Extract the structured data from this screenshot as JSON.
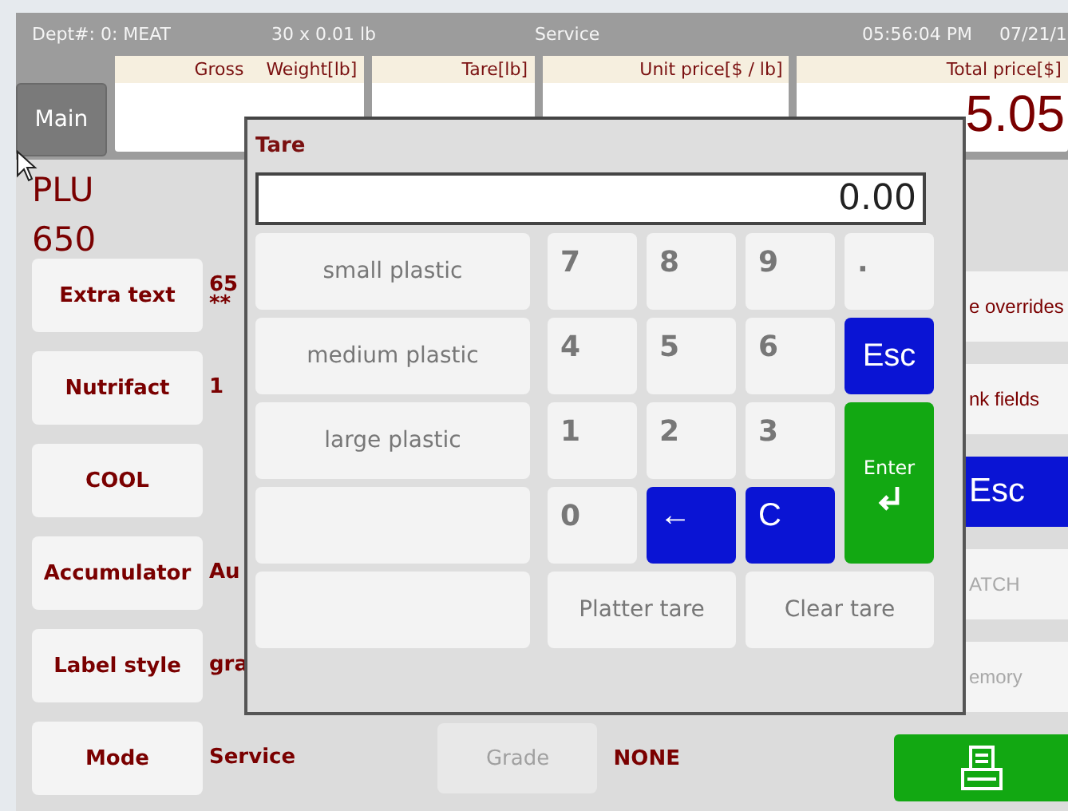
{
  "status_bar": {
    "department": "Dept#: 0: MEAT",
    "tare_info": "30 x 0.01 lb",
    "mode": "Service",
    "time": "05:56:04 PM",
    "date": "07/21/1"
  },
  "main_button": "Main",
  "readouts": [
    {
      "label": "Gross    Weight[lb]"
    },
    {
      "label": "Tare[lb]"
    },
    {
      "label": "Unit price[$ / lb]"
    },
    {
      "label": "Total price[$]",
      "value": "5.05"
    }
  ],
  "plu": {
    "label": "PLU",
    "number": "650"
  },
  "fields": [
    {
      "button": "Extra text",
      "value": "65",
      "value_line_2": "**"
    },
    {
      "button": "Nutrifact",
      "value": "1"
    },
    {
      "button": "COOL"
    },
    {
      "button": "Accumulator",
      "value": "Au"
    },
    {
      "button": "Label style",
      "value": "gra"
    },
    {
      "button": "Mode",
      "value": "Service"
    }
  ],
  "grade": {
    "button": "Grade",
    "disabled": true,
    "value": "NONE"
  },
  "side_buttons": [
    {
      "kind": "normal",
      "label": "e overrides",
      "disabled": false
    },
    {
      "kind": "normal",
      "label": "nk fields",
      "disabled": false
    },
    {
      "kind": "blue",
      "label": "Esc"
    },
    {
      "kind": "normal",
      "label": "ATCH",
      "disabled": true
    },
    {
      "kind": "normal",
      "label": "emory",
      "disabled": true
    },
    {
      "kind": "print"
    }
  ],
  "tare_dialog": {
    "title": "Tare",
    "value": "0.00",
    "presets": [
      {
        "kind": "preset",
        "label": "small plastic"
      },
      {
        "kind": "preset",
        "label": "medium plastic"
      },
      {
        "kind": "preset",
        "label": "large plastic"
      },
      {
        "kind": "empty"
      },
      {
        "kind": "empty"
      }
    ],
    "keys": [
      {
        "kind": "digit",
        "label": "7"
      },
      {
        "kind": "digit",
        "label": "8"
      },
      {
        "kind": "digit",
        "label": "9"
      },
      {
        "kind": "digit",
        "label": "."
      },
      {
        "kind": "digit",
        "label": "4"
      },
      {
        "kind": "digit",
        "label": "5"
      },
      {
        "kind": "digit",
        "label": "6"
      },
      {
        "kind": "blue",
        "label": "Esc"
      },
      {
        "kind": "digit",
        "label": "1"
      },
      {
        "kind": "digit",
        "label": "2"
      },
      {
        "kind": "digit",
        "label": "3"
      },
      {
        "kind": "enter",
        "label": "Enter"
      },
      {
        "kind": "digit",
        "label": "0"
      },
      {
        "kind": "blue",
        "label": "←"
      },
      {
        "kind": "blue",
        "label": "C"
      }
    ],
    "actions": [
      "Platter tare",
      "Clear tare"
    ]
  }
}
